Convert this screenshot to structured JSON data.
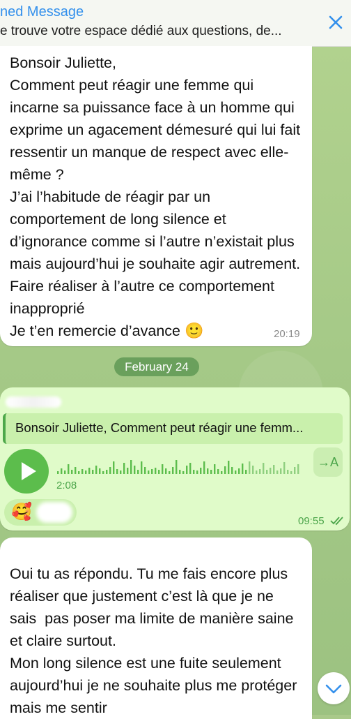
{
  "pinned": {
    "title": "ned Message",
    "text": "e trouve votre espace dédié aux questions, de..."
  },
  "messages": {
    "incoming1": {
      "text": "Bonsoir Juliette,\nComment peut réagir une femme qui incarne sa puissance face à un homme qui exprime un agacement démesuré qui lui fait ressentir un manque de respect avec elle-même ?\nJ’ai l’habitude de réagir par un comportement de long silence et d’ignorance comme si l’autre n’existait plus mais aujourd’hui je souhaite agir autrement. Faire réaliser à l’autre ce comportement inapproprié\nJe t’en remercie d’avance ",
      "emoji": "🙂",
      "time": "20:19"
    },
    "date_separator": "February 24",
    "outgoing_voice": {
      "reply_text": "Bonsoir Juliette, Comment peut réagir une femm...",
      "duration": "2:08",
      "transcribe_label": "→A",
      "reaction_emoji": "🥰",
      "time": "09:55"
    },
    "incoming2": {
      "text": "Oui tu as répondu. Tu me fais encore plus réaliser que justement c’est là que je ne sais  pas poser ma limite de manière saine et claire surtout.\nMon long silence est une fuite seulement aujourd’hui je ne souhaite plus me protéger mais me sentir"
    }
  },
  "colors": {
    "accent": "#3390ec",
    "outgoing_bubble": "#e0fbc9",
    "voice_green": "#5cbd4c",
    "chat_background": "#a9c98a"
  },
  "icons": {
    "close": "close-icon",
    "play": "play-icon",
    "read_checks": "double-check-icon",
    "scroll_down": "chevron-down-icon"
  }
}
